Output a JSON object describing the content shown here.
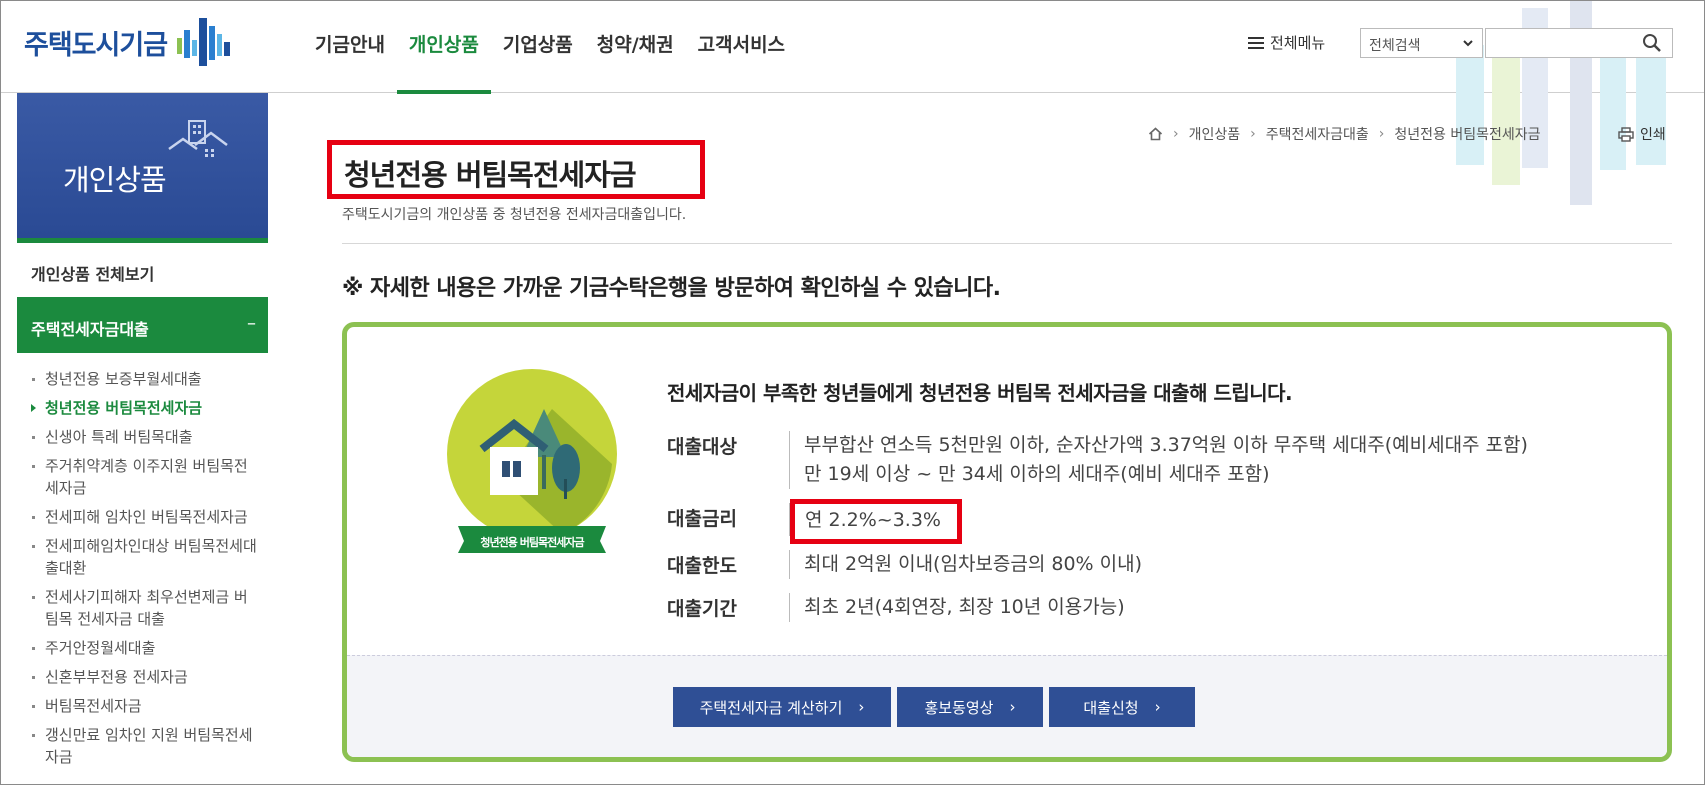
{
  "logo": {
    "text": "주택도시기금"
  },
  "gnb": [
    {
      "label": "기금안내",
      "active": false
    },
    {
      "label": "개인상품",
      "active": true
    },
    {
      "label": "기업상품",
      "active": false
    },
    {
      "label": "청약/채권",
      "active": false
    },
    {
      "label": "고객서비스",
      "active": false
    }
  ],
  "header": {
    "allmenu_label": "전체메뉴",
    "search_scope": "전체검색",
    "search_placeholder": ""
  },
  "sidebar": {
    "title": "개인상품",
    "all_link": "개인상품 전체보기",
    "group_label": "주택전세자금대출",
    "group_toggle": "–",
    "items": [
      {
        "label": "청년전용 보증부월세대출",
        "current": false
      },
      {
        "label": "청년전용 버팀목전세자금",
        "current": true
      },
      {
        "label": "신생아 특례 버팀목대출",
        "current": false
      },
      {
        "label": "주거취약계층 이주지원 버팀목전세자금",
        "current": false
      },
      {
        "label": "전세피해 임차인 버팀목전세자금",
        "current": false
      },
      {
        "label": "전세피해임차인대상 버팀목전세대출대환",
        "current": false
      },
      {
        "label": "전세사기피해자 최우선변제금 버팀목 전세자금 대출",
        "current": false
      },
      {
        "label": "주거안정월세대출",
        "current": false
      },
      {
        "label": "신혼부부전용 전세자금",
        "current": false
      },
      {
        "label": "버팀목전세자금",
        "current": false
      },
      {
        "label": "갱신만료 임차인 지원 버팀목전세자금",
        "current": false
      }
    ]
  },
  "breadcrumb": [
    "개인상품",
    "주택전세자금대출",
    "청년전용 버팀목전세자금"
  ],
  "print_label": "인쇄",
  "page": {
    "title": "청년전용 버팀목전세자금",
    "description": "주택도시기금의 개인상품 중 청년전용 전세자금대출입니다.",
    "notice": "※ 자세한 내용은 가까운 기금수탁은행을 방문하여 확인하실 수 있습니다."
  },
  "product": {
    "badge_label": "청년전용 버팀목전세자금",
    "lead": "전세자금이 부족한 청년들에게 청년전용 버팀목 전세자금을 대출해 드립니다.",
    "rows": [
      {
        "label": "대출대상",
        "lines": [
          "부부합산 연소득 5천만원 이하, 순자산가액 3.37억원 이하 무주택 세대주(예비세대주 포함)",
          "만 19세 이상 ~ 만 34세 이하의 세대주(예비 세대주 포함)"
        ]
      },
      {
        "label": "대출금리",
        "lines": [
          "연 2.2%~3.3%"
        ]
      },
      {
        "label": "대출한도",
        "lines": [
          "최대 2억원 이내(임차보증금의 80% 이내)"
        ]
      },
      {
        "label": "대출기간",
        "lines": [
          "최초 2년(4회연장, 최장 10년 이용가능)"
        ]
      }
    ],
    "buttons": [
      "주택전세자금 계산하기",
      "홍보동영상",
      "대출신청"
    ]
  },
  "colors": {
    "brand_blue": "#2f4f95",
    "brand_green": "#1b8a3e",
    "highlight_red": "#e60012",
    "box_border_green": "#8cc152"
  }
}
